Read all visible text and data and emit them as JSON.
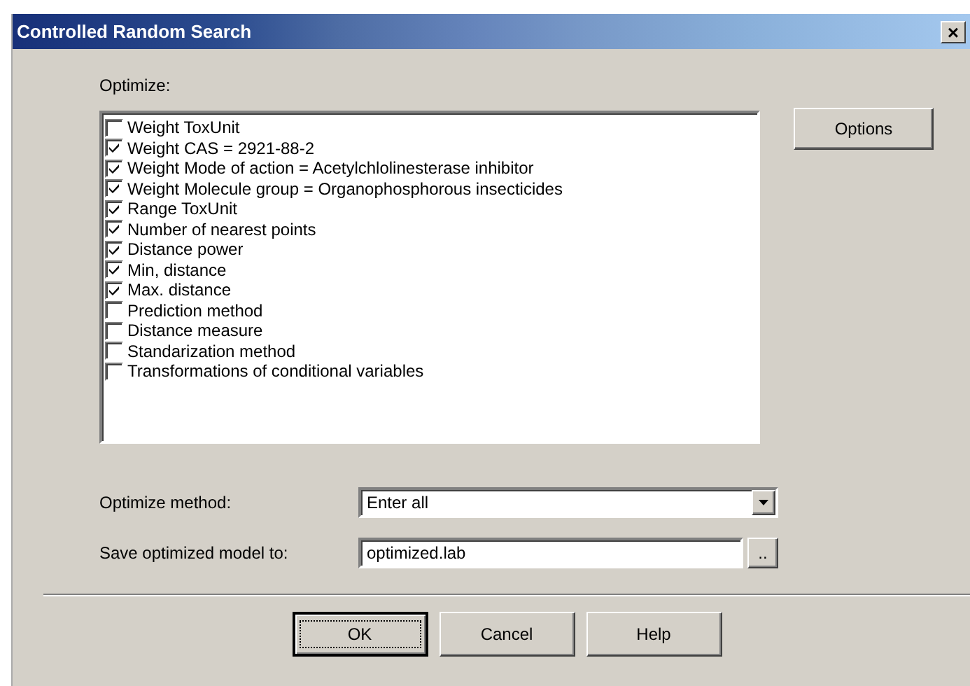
{
  "window": {
    "title": "Controlled Random Search",
    "close": "×"
  },
  "optimize": {
    "label": "Optimize:",
    "items": [
      {
        "label": "Weight ToxUnit",
        "checked": false
      },
      {
        "label": "Weight CAS = 2921-88-2",
        "checked": true
      },
      {
        "label": "Weight Mode of action = Acetylchlolinesterase inhibitor",
        "checked": true
      },
      {
        "label": "Weight Molecule group = Organophosphorous insecticides",
        "checked": true
      },
      {
        "label": "Range ToxUnit",
        "checked": true
      },
      {
        "label": "Number of nearest points",
        "checked": true
      },
      {
        "label": "Distance power",
        "checked": true
      },
      {
        "label": "Min, distance",
        "checked": true
      },
      {
        "label": "Max. distance",
        "checked": true
      },
      {
        "label": "Prediction method",
        "checked": false
      },
      {
        "label": "Distance measure",
        "checked": false
      },
      {
        "label": "Standarization method",
        "checked": false
      },
      {
        "label": "Transformations of conditional variables",
        "checked": false
      }
    ]
  },
  "options_button": "Options",
  "method": {
    "label": "Optimize method:",
    "value": "Enter all"
  },
  "save": {
    "label": "Save optimized model to:",
    "value": "optimized.lab",
    "browse": ".."
  },
  "buttons": [
    {
      "label": "OK",
      "default": true
    },
    {
      "label": "Cancel",
      "default": false
    },
    {
      "label": "Help",
      "default": false
    }
  ]
}
